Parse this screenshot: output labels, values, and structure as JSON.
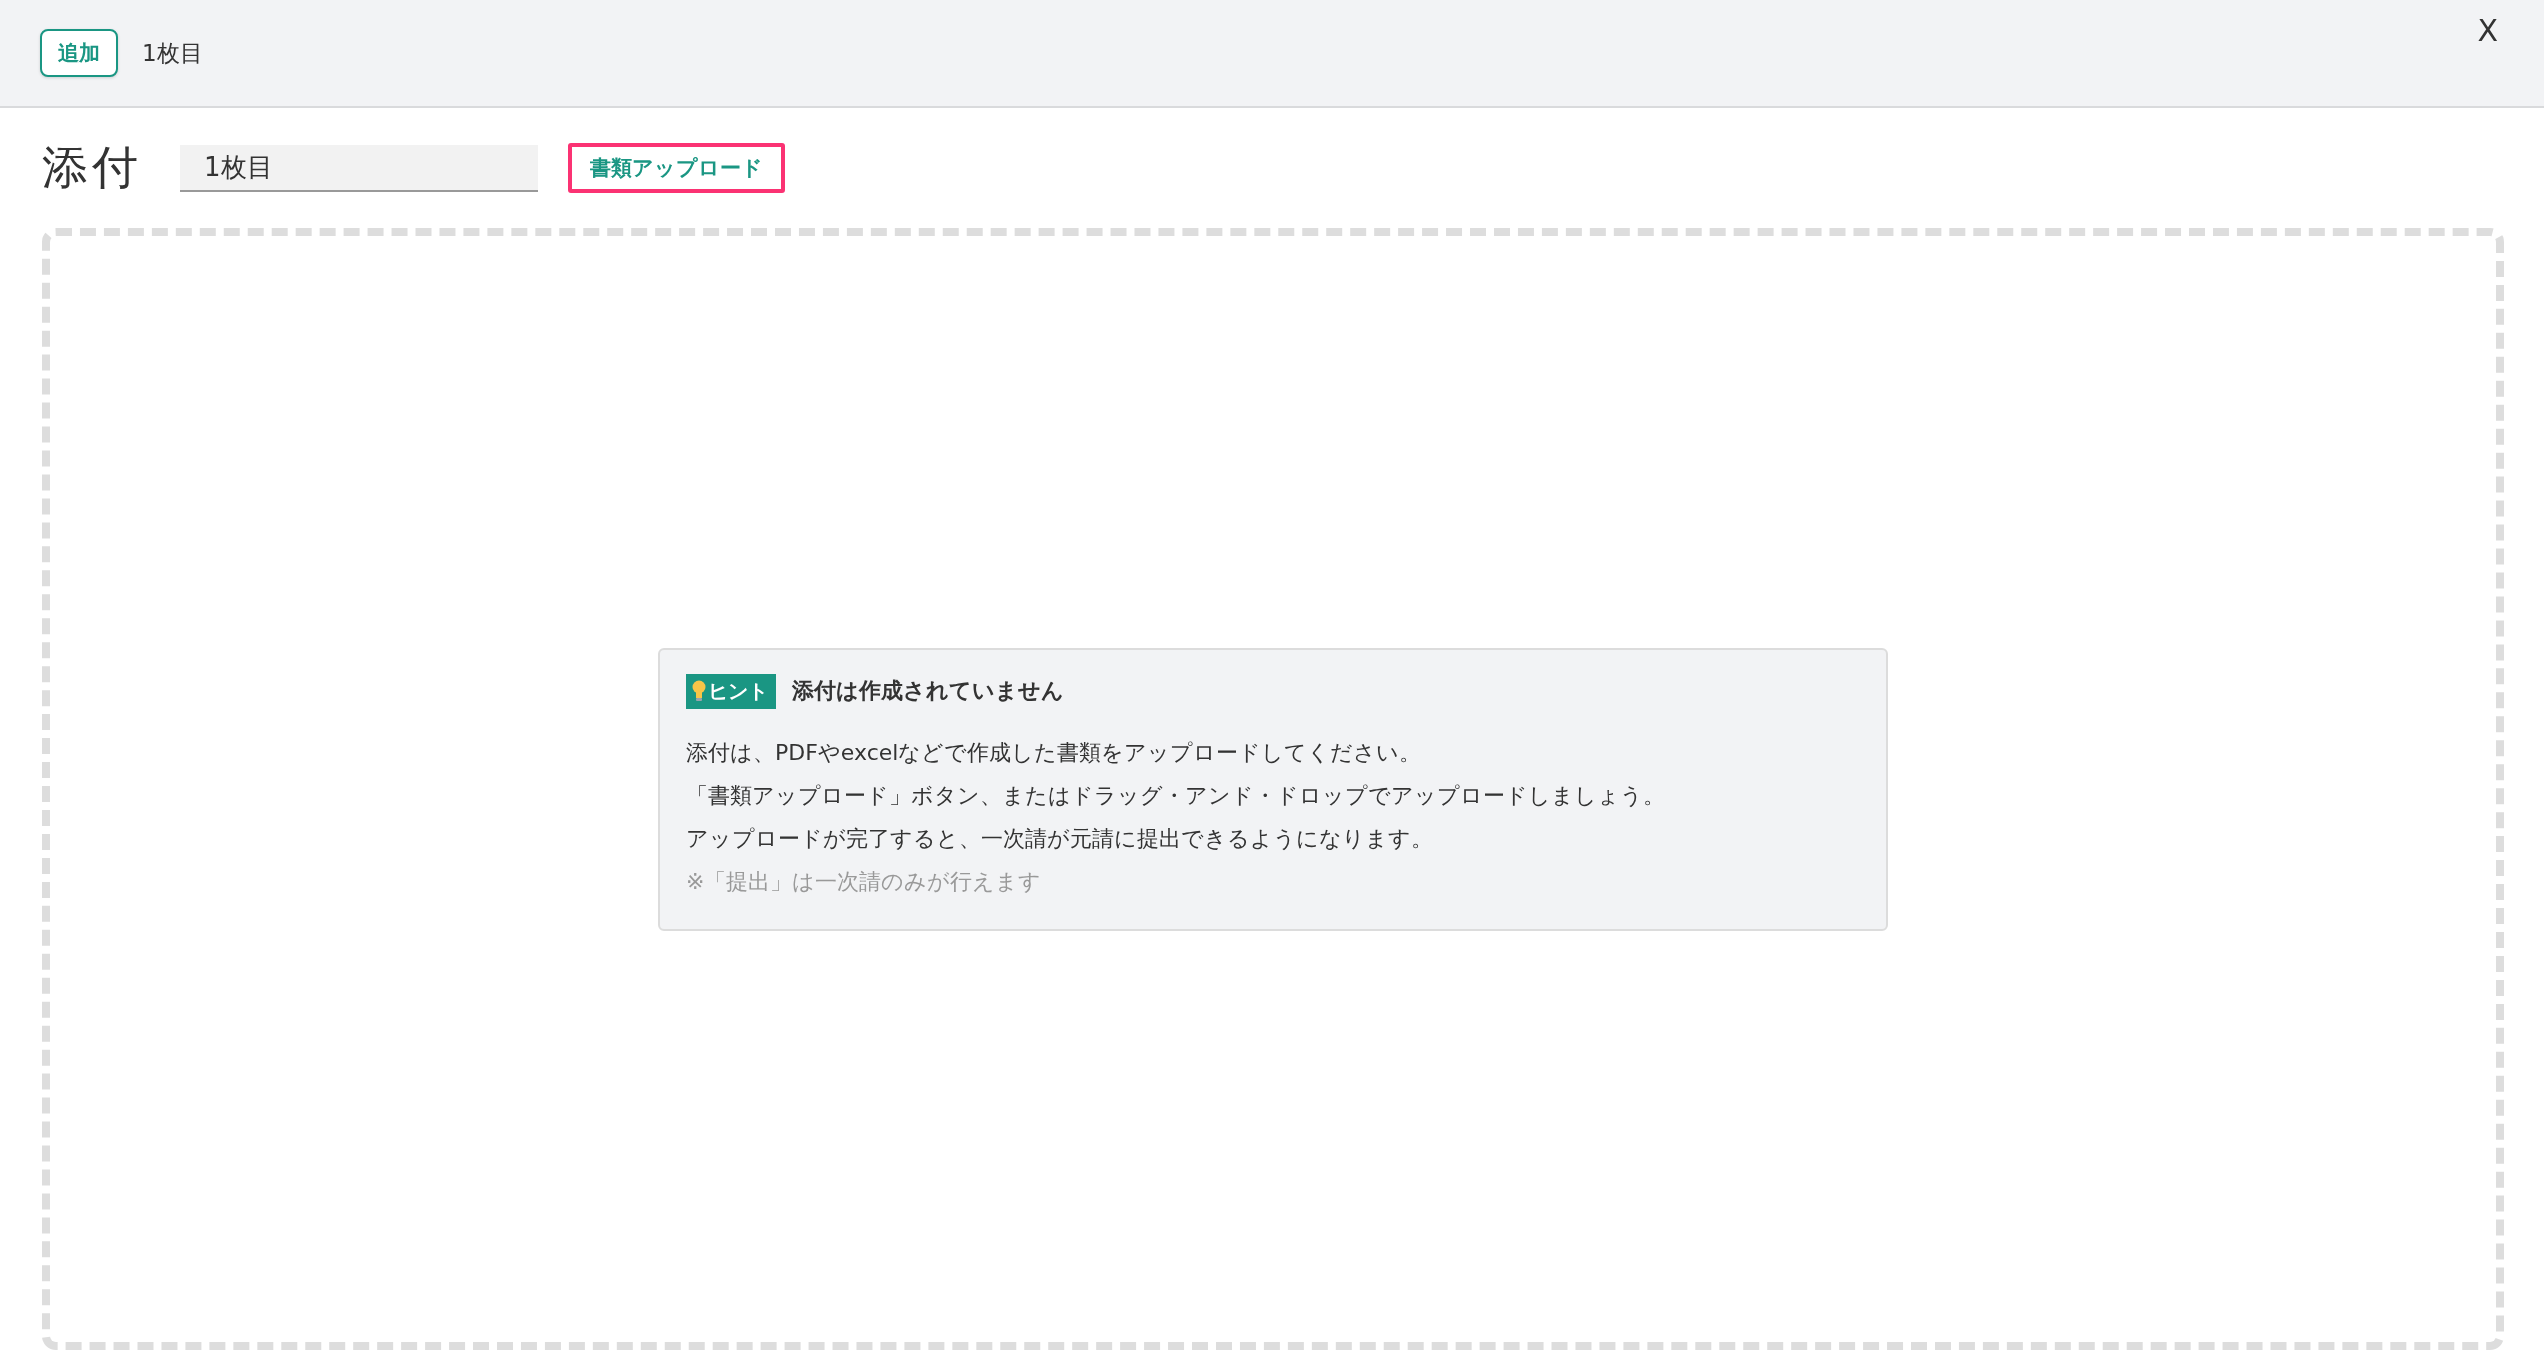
{
  "header": {
    "add_button": "追加",
    "page_label": "1枚目",
    "close_button": "X"
  },
  "attachment": {
    "title": "添付",
    "name_field": {
      "value": "1枚目"
    },
    "upload_button": {
      "label": "書類アップロード",
      "highlighted": true
    }
  },
  "hint": {
    "badge": "ヒント",
    "title": "添付は作成されていません",
    "lines": [
      "添付は、PDFやexcelなどで作成した書類をアップロードしてください。",
      "「書類アップロード」ボタン、またはドラッグ・アンド・ドロップでアップロードしましょう。",
      "アップロードが完了すると、一次請が元請に提出できるようになります。"
    ],
    "note": "※「提出」は一次請のみが行えます"
  }
}
